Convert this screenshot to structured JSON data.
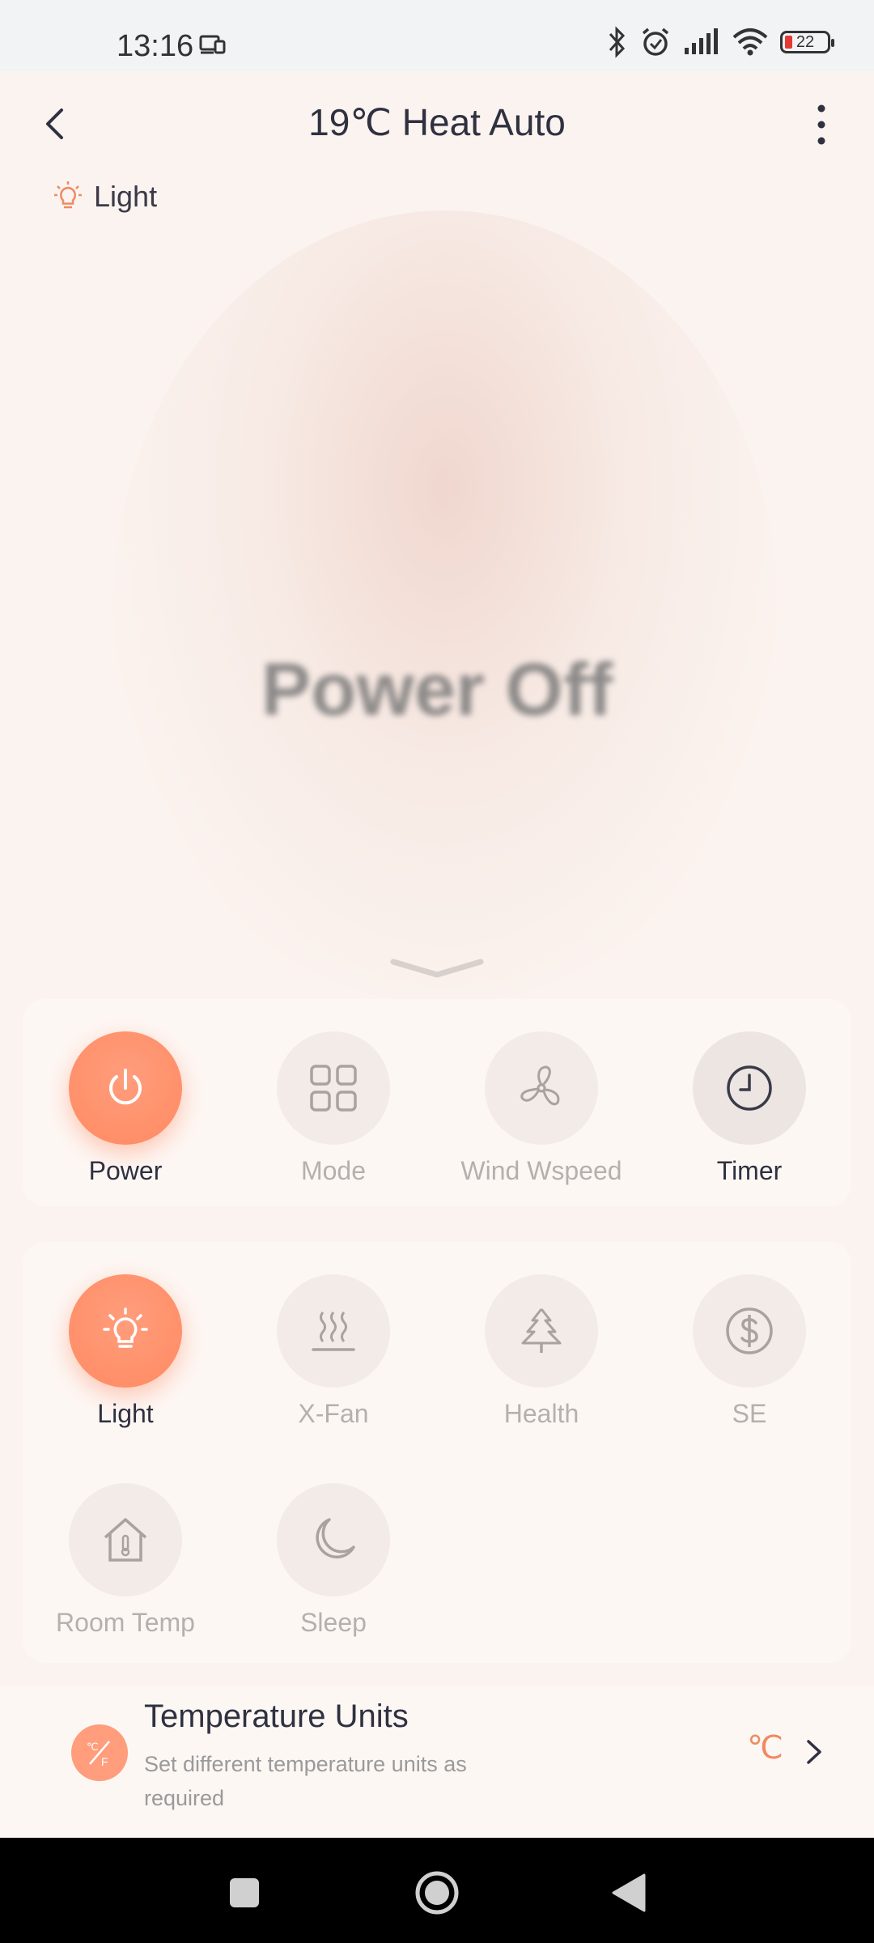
{
  "status_bar": {
    "time": "13:16",
    "battery": "22"
  },
  "header": {
    "title": "19℃ Heat Auto",
    "light_tag": "Light"
  },
  "display": {
    "state_text": "Power Off"
  },
  "primary_controls": [
    {
      "label": "Power",
      "active": true
    },
    {
      "label": "Mode",
      "active": false
    },
    {
      "label": "Wind Wspeed",
      "active": false
    },
    {
      "label": "Timer",
      "active": true
    }
  ],
  "secondary_controls": [
    {
      "label": "Light",
      "active": true
    },
    {
      "label": "X-Fan",
      "active": false
    },
    {
      "label": "Health",
      "active": false
    },
    {
      "label": "SE",
      "active": false
    },
    {
      "label": "Room Temp",
      "active": false
    },
    {
      "label": "Sleep",
      "active": false
    }
  ],
  "temperature_units": {
    "title": "Temperature Units",
    "subtitle": "Set different temperature units as required",
    "value": "℃"
  },
  "colors": {
    "accent": "#ff8a62",
    "background": "#fbf3ef",
    "text": "#2f3140",
    "muted": "#b5b0ae"
  }
}
